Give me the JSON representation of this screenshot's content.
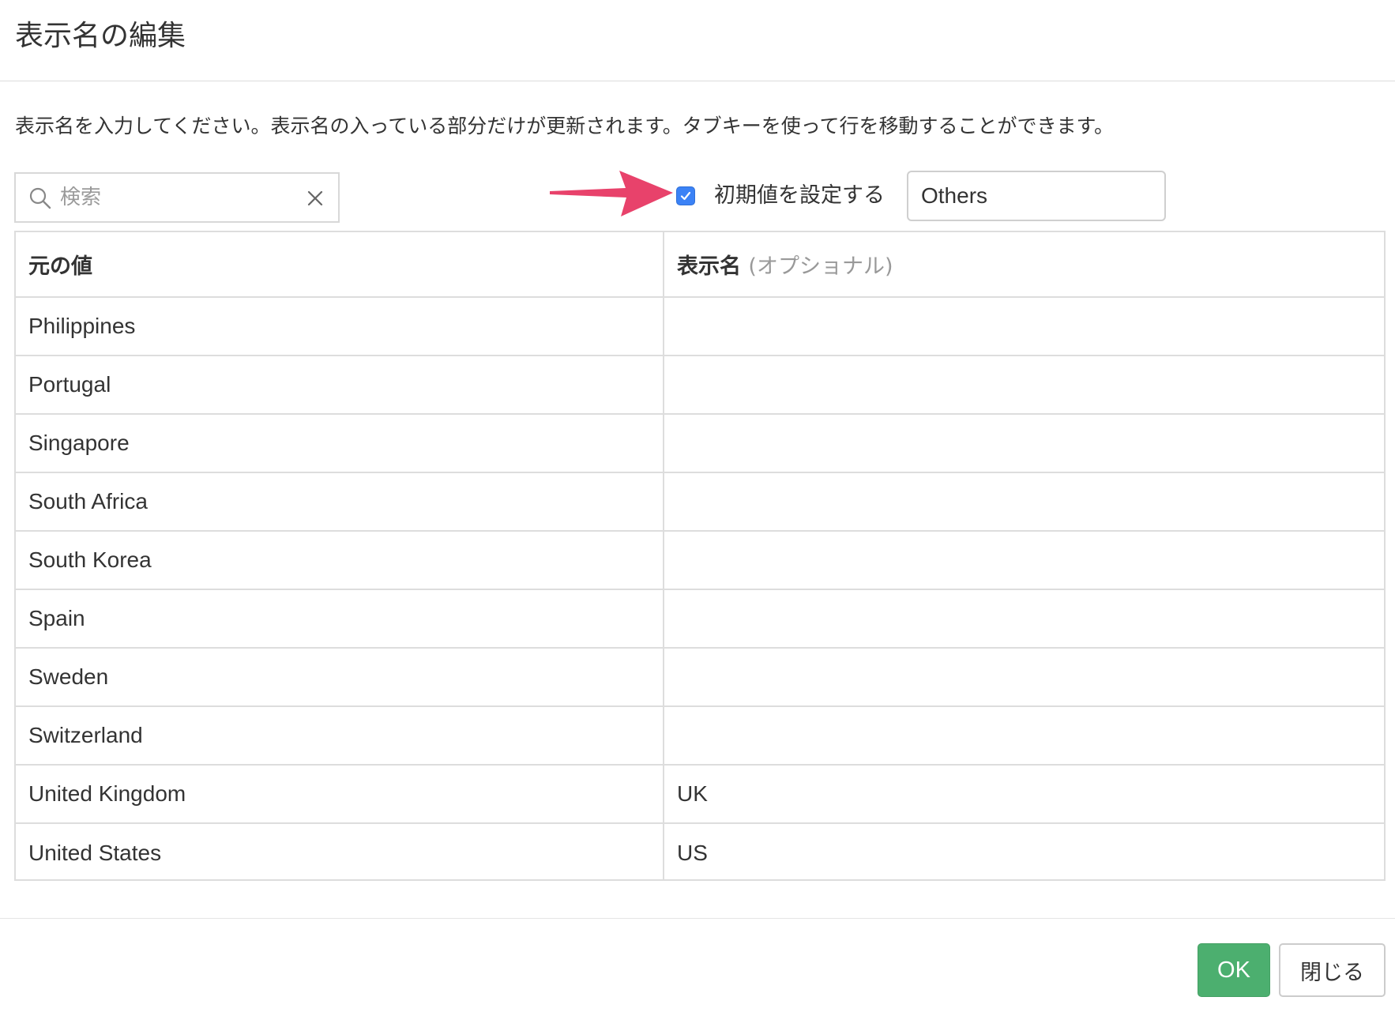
{
  "dialog": {
    "title": "表示名の編集",
    "description": "表示名を入力してください。表示名の入っている部分だけが更新されます。タブキーを使って行を移動することができます。"
  },
  "search": {
    "placeholder": "検索",
    "value": ""
  },
  "default_value": {
    "checked": true,
    "label": "初期値を設定する",
    "value": "Others"
  },
  "table": {
    "header_original": "元の値",
    "header_display": "表示名",
    "header_display_note": "(オプショナル)",
    "rows": [
      {
        "original": "Philippines",
        "display": ""
      },
      {
        "original": "Portugal",
        "display": ""
      },
      {
        "original": "Singapore",
        "display": ""
      },
      {
        "original": "South Africa",
        "display": ""
      },
      {
        "original": "South Korea",
        "display": ""
      },
      {
        "original": "Spain",
        "display": ""
      },
      {
        "original": "Sweden",
        "display": ""
      },
      {
        "original": "Switzerland",
        "display": ""
      },
      {
        "original": "United Kingdom",
        "display": "UK"
      },
      {
        "original": "United States",
        "display": "US"
      }
    ]
  },
  "footer": {
    "ok_label": "OK",
    "close_label": "閉じる"
  },
  "colors": {
    "ok_button": "#4caf6f",
    "checkbox": "#3b82f6",
    "annotation_arrow": "#e8426b"
  },
  "icons": {
    "search": "search-icon",
    "clear": "close-icon",
    "check": "checkmark-icon",
    "annotation": "arrow-right-icon"
  }
}
